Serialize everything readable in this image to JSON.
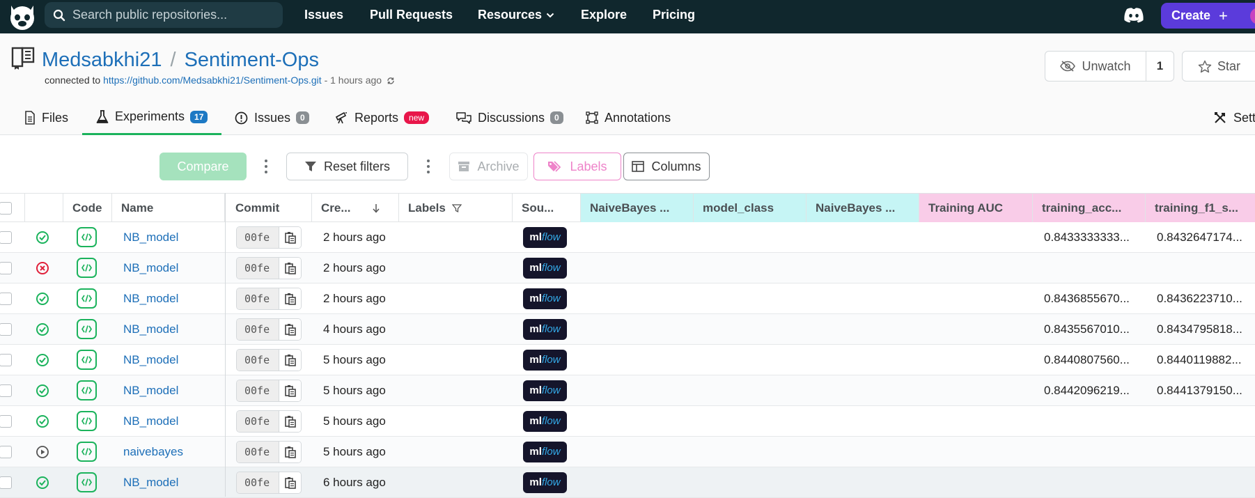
{
  "nav": {
    "search_placeholder": "Search public repositories...",
    "links": [
      "Issues",
      "Pull Requests",
      "Resources",
      "Explore",
      "Pricing"
    ],
    "create_label": "Create"
  },
  "repo": {
    "owner": "Medsabkhi21",
    "name": "Sentiment-Ops",
    "connected_prefix": "connected to",
    "connected_url": "https://github.com/Medsabkhi21/Sentiment-Ops.git",
    "connected_time": "- 1 hours ago",
    "watch_label": "Unwatch",
    "watch_count": "1",
    "star_label": "Star"
  },
  "tabs": [
    {
      "label": "Files",
      "badge": ""
    },
    {
      "label": "Experiments",
      "badge": "17"
    },
    {
      "label": "Issues",
      "badge": "0"
    },
    {
      "label": "Reports",
      "badge": "new"
    },
    {
      "label": "Discussions",
      "badge": "0"
    },
    {
      "label": "Annotations",
      "badge": ""
    },
    {
      "label": "Setti",
      "badge": ""
    }
  ],
  "toolbar": {
    "compare": "Compare",
    "reset_filters": "Reset filters",
    "archive": "Archive",
    "labels": "Labels",
    "columns": "Columns"
  },
  "table": {
    "headers": {
      "code": "Code",
      "name": "Name",
      "commit": "Commit",
      "created": "Cre...",
      "labels": "Labels",
      "source": "Sou...",
      "p1": "NaiveBayes ...",
      "p2": "model_class",
      "p3": "NaiveBayes ...",
      "m1": "Training AUC",
      "m2": "training_acc...",
      "m3": "training_f1_s..."
    },
    "rows": [
      {
        "status": "success",
        "name": "NB_model",
        "commit": "00fe",
        "created": "2 hours ago",
        "acc": "0.8433333333...",
        "f1": "0.8432647174..."
      },
      {
        "status": "failed",
        "name": "NB_model",
        "commit": "00fe",
        "created": "2 hours ago",
        "acc": "",
        "f1": ""
      },
      {
        "status": "success",
        "name": "NB_model",
        "commit": "00fe",
        "created": "2 hours ago",
        "acc": "0.8436855670...",
        "f1": "0.8436223710..."
      },
      {
        "status": "success",
        "name": "NB_model",
        "commit": "00fe",
        "created": "4 hours ago",
        "acc": "0.8435567010...",
        "f1": "0.8434795818..."
      },
      {
        "status": "success",
        "name": "NB_model",
        "commit": "00fe",
        "created": "5 hours ago",
        "acc": "0.8440807560...",
        "f1": "0.8440119882..."
      },
      {
        "status": "success",
        "name": "NB_model",
        "commit": "00fe",
        "created": "5 hours ago",
        "acc": "0.8442096219...",
        "f1": "0.8441379150..."
      },
      {
        "status": "success",
        "name": "NB_model",
        "commit": "00fe",
        "created": "5 hours ago",
        "acc": "",
        "f1": ""
      },
      {
        "status": "running",
        "name": "naivebayes",
        "commit": "00fe",
        "created": "5 hours ago",
        "acc": "",
        "f1": ""
      },
      {
        "status": "success",
        "name": "NB_model",
        "commit": "00fe",
        "created": "6 hours ago",
        "acc": "",
        "f1": ""
      }
    ]
  },
  "source_badge": {
    "ml": "ml",
    "flow": "flow"
  }
}
